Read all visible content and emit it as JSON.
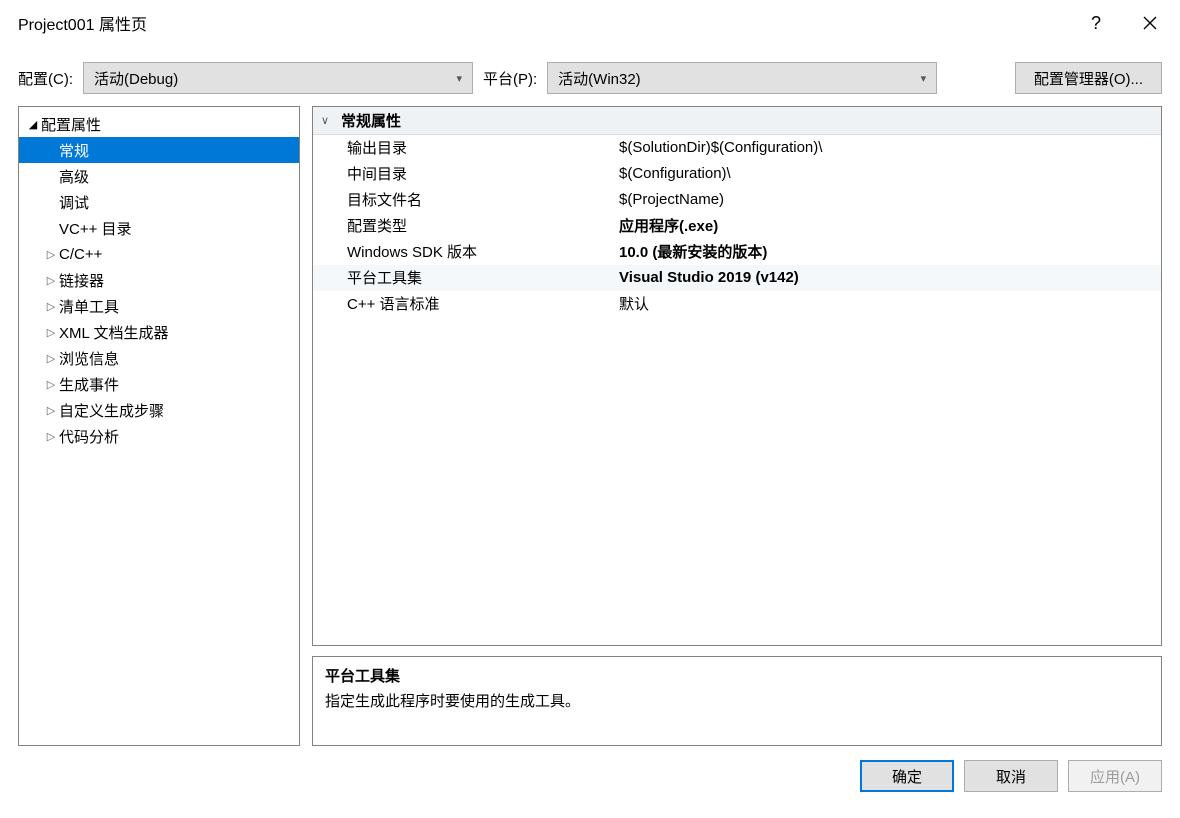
{
  "window": {
    "title": "Project001 属性页",
    "helpIcon": "?",
    "closeIcon": "✕"
  },
  "topRow": {
    "configLabel": "配置(C):",
    "configValue": "活动(Debug)",
    "platformLabel": "平台(P):",
    "platformValue": "活动(Win32)",
    "configMgrBtn": "配置管理器(O)..."
  },
  "tree": {
    "root": {
      "label": "配置属性"
    },
    "items": [
      {
        "label": "常规",
        "selected": true,
        "hasChildren": false
      },
      {
        "label": "高级",
        "selected": false,
        "hasChildren": false
      },
      {
        "label": "调试",
        "selected": false,
        "hasChildren": false
      },
      {
        "label": "VC++ 目录",
        "selected": false,
        "hasChildren": false
      },
      {
        "label": "C/C++",
        "selected": false,
        "hasChildren": true
      },
      {
        "label": "链接器",
        "selected": false,
        "hasChildren": true
      },
      {
        "label": "清单工具",
        "selected": false,
        "hasChildren": true
      },
      {
        "label": "XML 文档生成器",
        "selected": false,
        "hasChildren": true
      },
      {
        "label": "浏览信息",
        "selected": false,
        "hasChildren": true
      },
      {
        "label": "生成事件",
        "selected": false,
        "hasChildren": true
      },
      {
        "label": "自定义生成步骤",
        "selected": false,
        "hasChildren": true
      },
      {
        "label": "代码分析",
        "selected": false,
        "hasChildren": true
      }
    ]
  },
  "propGrid": {
    "groupTitle": "常规属性",
    "rows": [
      {
        "name": "输出目录",
        "value": "$(SolutionDir)$(Configuration)\\",
        "bold": false,
        "hl": false
      },
      {
        "name": "中间目录",
        "value": "$(Configuration)\\",
        "bold": false,
        "hl": false
      },
      {
        "name": "目标文件名",
        "value": "$(ProjectName)",
        "bold": false,
        "hl": false
      },
      {
        "name": "配置类型",
        "value": "应用程序(.exe)",
        "bold": true,
        "hl": false
      },
      {
        "name": "Windows SDK 版本",
        "value": "10.0 (最新安装的版本)",
        "bold": true,
        "hl": false
      },
      {
        "name": "平台工具集",
        "value": "Visual Studio 2019 (v142)",
        "bold": true,
        "hl": true
      },
      {
        "name": "C++ 语言标准",
        "value": "默认",
        "bold": false,
        "hl": false
      }
    ]
  },
  "descBox": {
    "title": "平台工具集",
    "text": "指定生成此程序时要使用的生成工具。"
  },
  "buttons": {
    "ok": "确定",
    "cancel": "取消",
    "apply": "应用(A)"
  },
  "icons": {
    "chevronDown": "▾",
    "triangleRight": "▷",
    "triangleDown": "◢",
    "collapseToggle": "∨"
  }
}
